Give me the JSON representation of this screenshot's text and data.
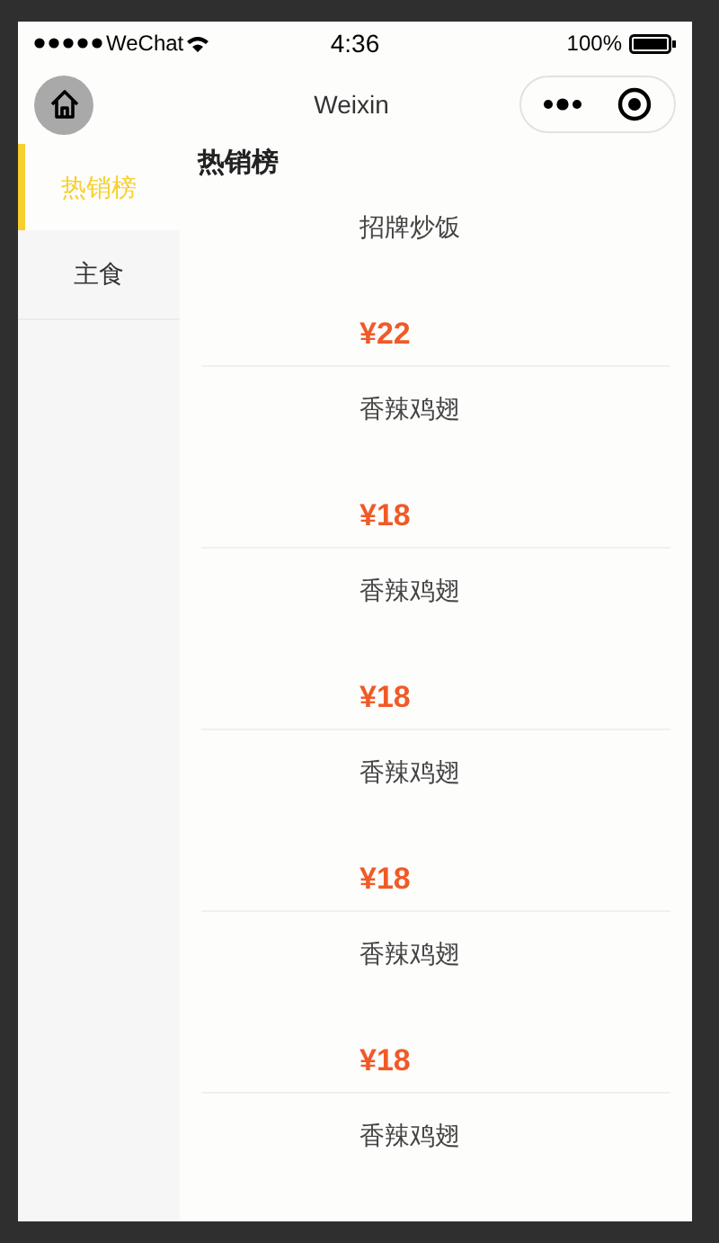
{
  "status_bar": {
    "carrier": "WeChat",
    "time": "4:36",
    "battery": "100%"
  },
  "nav_bar": {
    "title": "Weixin"
  },
  "sidebar": {
    "items": [
      {
        "label": "热销榜",
        "selected": true
      },
      {
        "label": "主食",
        "selected": false
      }
    ]
  },
  "section_title": "热销榜",
  "products": [
    {
      "name": "招牌炒饭",
      "price": "¥22"
    },
    {
      "name": "香辣鸡翅",
      "price": "¥18"
    },
    {
      "name": "香辣鸡翅",
      "price": "¥18"
    },
    {
      "name": "香辣鸡翅",
      "price": "¥18"
    },
    {
      "name": "香辣鸡翅",
      "price": "¥18"
    },
    {
      "name": "香辣鸡翅"
    }
  ]
}
